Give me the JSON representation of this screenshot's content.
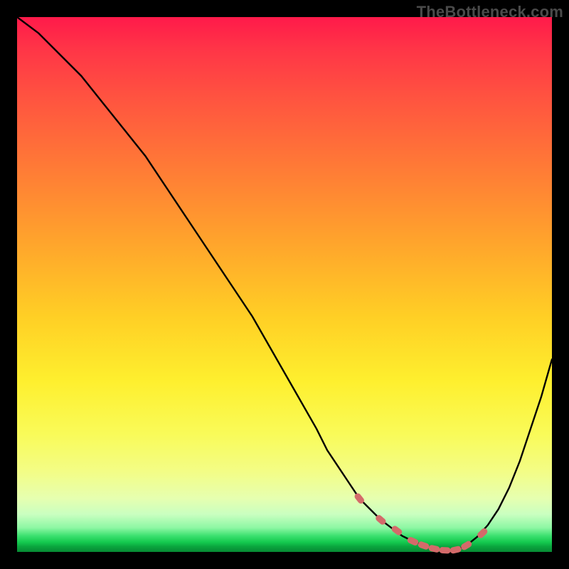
{
  "watermark": "TheBottleneck.com",
  "colors": {
    "curve_stroke": "#000000",
    "marker_fill": "#d46a6a",
    "background": "#000000"
  },
  "chart_data": {
    "type": "line",
    "title": "",
    "xlabel": "",
    "ylabel": "",
    "xlim": [
      0,
      100
    ],
    "ylim": [
      0,
      100
    ],
    "grid": false,
    "legend": false,
    "annotations": [],
    "series": [
      {
        "name": "bottleneck-curve",
        "x": [
          0,
          4,
          8,
          12,
          16,
          20,
          24,
          28,
          32,
          36,
          40,
          44,
          48,
          52,
          56,
          58,
          60,
          62,
          64,
          66,
          68,
          70,
          72,
          74,
          76,
          78,
          80,
          82,
          84,
          86,
          88,
          90,
          92,
          94,
          96,
          98,
          100
        ],
        "values": [
          100,
          97,
          93,
          89,
          84,
          79,
          74,
          68,
          62,
          56,
          50,
          44,
          37,
          30,
          23,
          19,
          16,
          13,
          10,
          8,
          6,
          4.5,
          3,
          2,
          1.2,
          0.6,
          0.3,
          0.4,
          1.2,
          2.8,
          5,
          8,
          12,
          17,
          23,
          29,
          36
        ]
      }
    ],
    "markers": {
      "name": "near-minimum-dots",
      "x": [
        64,
        68,
        71,
        74,
        76,
        78,
        80,
        82,
        84,
        87
      ],
      "values": [
        10.0,
        6.0,
        4.0,
        2.0,
        1.2,
        0.6,
        0.3,
        0.4,
        1.2,
        3.5
      ]
    }
  }
}
